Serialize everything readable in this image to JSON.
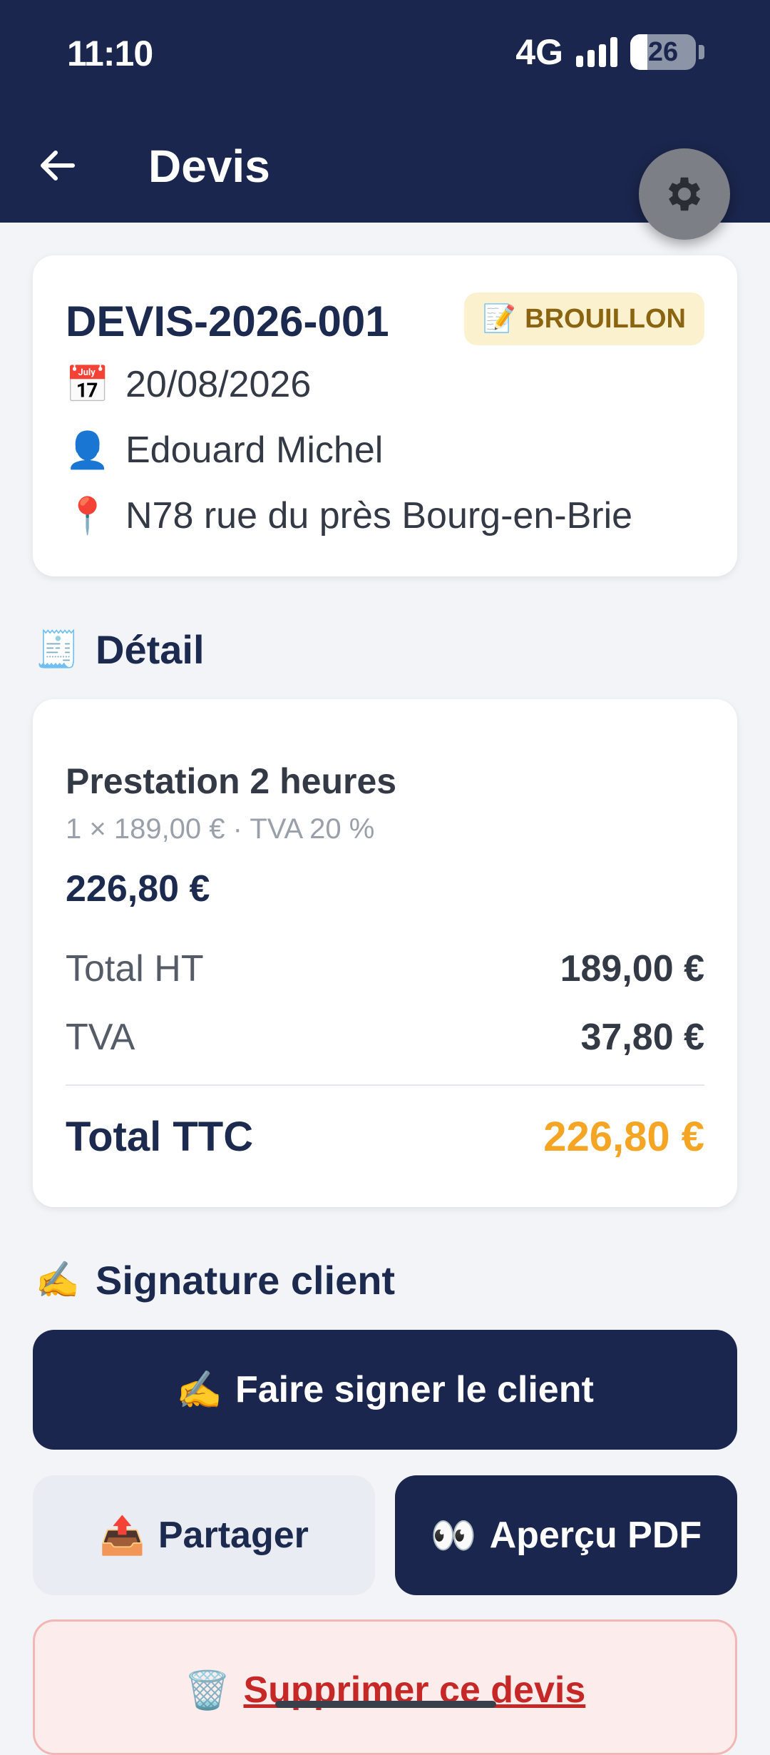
{
  "status_bar": {
    "time": "11:10",
    "network": "4G",
    "battery": "26"
  },
  "app_bar": {
    "title": "Devis"
  },
  "quote": {
    "number": "DEVIS-2026-001",
    "status": "BROUILLON",
    "date": "20/08/2026",
    "client": "Edouard Michel",
    "address": "N78 rue du près Bourg-en-Brie"
  },
  "detail": {
    "section_title": "Détail",
    "item": {
      "name": "Prestation 2 heures",
      "meta": "1 × 189,00 € · TVA 20 %",
      "total": "226,80 €"
    },
    "totals": {
      "ht_label": "Total HT",
      "ht_value": "189,00 €",
      "tva_label": "TVA",
      "tva_value": "37,80 €",
      "ttc_label": "Total TTC",
      "ttc_value": "226,80 €"
    }
  },
  "signature": {
    "section_title": "Signature client",
    "sign_button": "Faire signer le client"
  },
  "actions": {
    "share": "Partager",
    "preview_pdf": "Aperçu PDF",
    "delete": "Supprimer ce devis"
  },
  "colors": {
    "primary": "#1a264d",
    "accent": "#f4a524",
    "danger": "#c62828",
    "badge_bg": "#fcf1cf"
  }
}
